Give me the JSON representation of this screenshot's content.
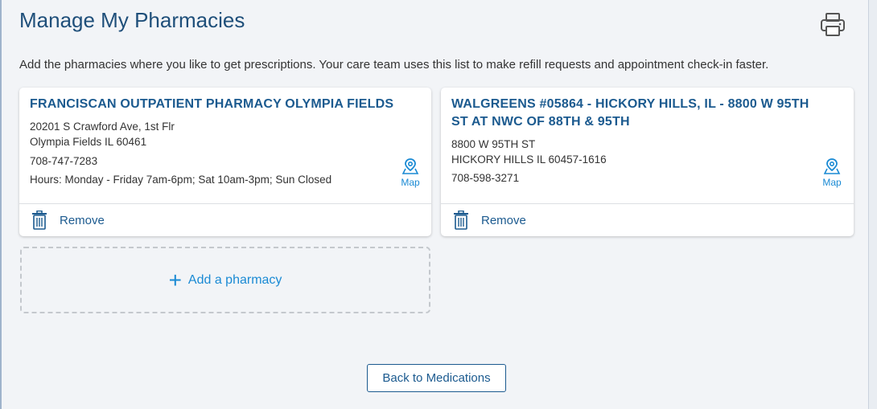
{
  "header": {
    "title": "Manage My Pharmacies",
    "description": "Add the pharmacies where you like to get prescriptions. Your care team uses this list to make refill requests and appointment check-in faster."
  },
  "pharmacies": [
    {
      "name": "FRANCISCAN OUTPATIENT PHARMACY OLYMPIA FIELDS",
      "address_line1": "20201 S Crawford Ave, 1st Flr",
      "address_line2": "Olympia Fields IL 60461",
      "phone": "708-747-7283",
      "hours": "Hours: Monday - Friday 7am-6pm; Sat 10am-3pm; Sun Closed",
      "map_label": "Map",
      "remove_label": "Remove"
    },
    {
      "name": "WALGREENS #05864 - HICKORY HILLS, IL - 8800 W 95TH ST AT NWC OF 88TH & 95TH",
      "address_line1": "8800 W 95TH ST",
      "address_line2": "HICKORY HILLS IL 60457-1616",
      "phone": "708-598-3271",
      "map_label": "Map",
      "remove_label": "Remove"
    }
  ],
  "add_pharmacy": {
    "label": "Add a pharmacy"
  },
  "footer": {
    "back_label": "Back to Medications"
  },
  "icons": {
    "print": "printer-icon",
    "map": "map-pin-icon",
    "remove": "trash-icon",
    "add": "plus-icon"
  },
  "colors": {
    "title": "#1f4f7a",
    "link": "#1b5a8f",
    "accent": "#1a8ad4",
    "background": "#f2f4f7"
  }
}
